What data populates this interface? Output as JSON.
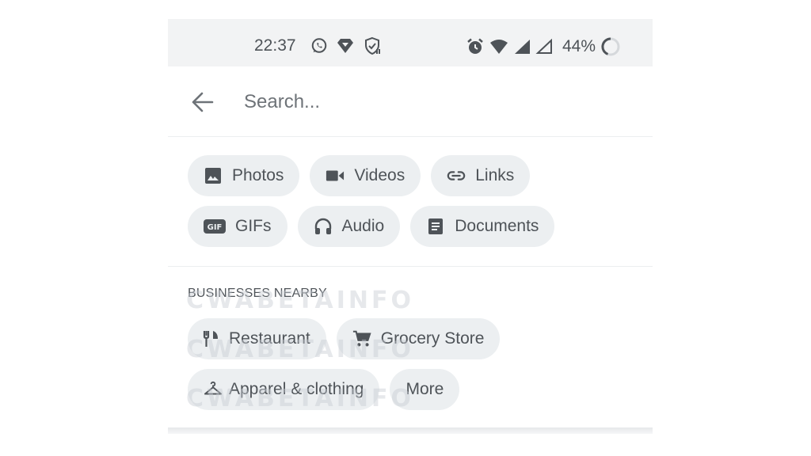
{
  "status_bar": {
    "time": "22:37",
    "battery": "44%"
  },
  "search": {
    "placeholder": "Search..."
  },
  "media_filters": [
    {
      "label": "Photos",
      "icon": "image-icon"
    },
    {
      "label": "Videos",
      "icon": "videocam-icon"
    },
    {
      "label": "Links",
      "icon": "link-icon"
    },
    {
      "label": "GIFs",
      "icon": "gif-icon"
    },
    {
      "label": "Audio",
      "icon": "headphones-icon"
    },
    {
      "label": "Documents",
      "icon": "document-icon"
    }
  ],
  "businesses": {
    "title": "BUSINESSES NEARBY",
    "items": [
      {
        "label": "Restaurant",
        "icon": "restaurant-icon"
      },
      {
        "label": "Grocery Store",
        "icon": "cart-icon"
      },
      {
        "label": "Apparel & clothing",
        "icon": "hanger-icon"
      },
      {
        "label": "More",
        "icon": ""
      }
    ]
  },
  "watermark": "CWABETAINFO",
  "colors": {
    "status_bar_bg": "#f2f3f4",
    "chip_bg": "#eceff1",
    "text": "#4e5358"
  }
}
